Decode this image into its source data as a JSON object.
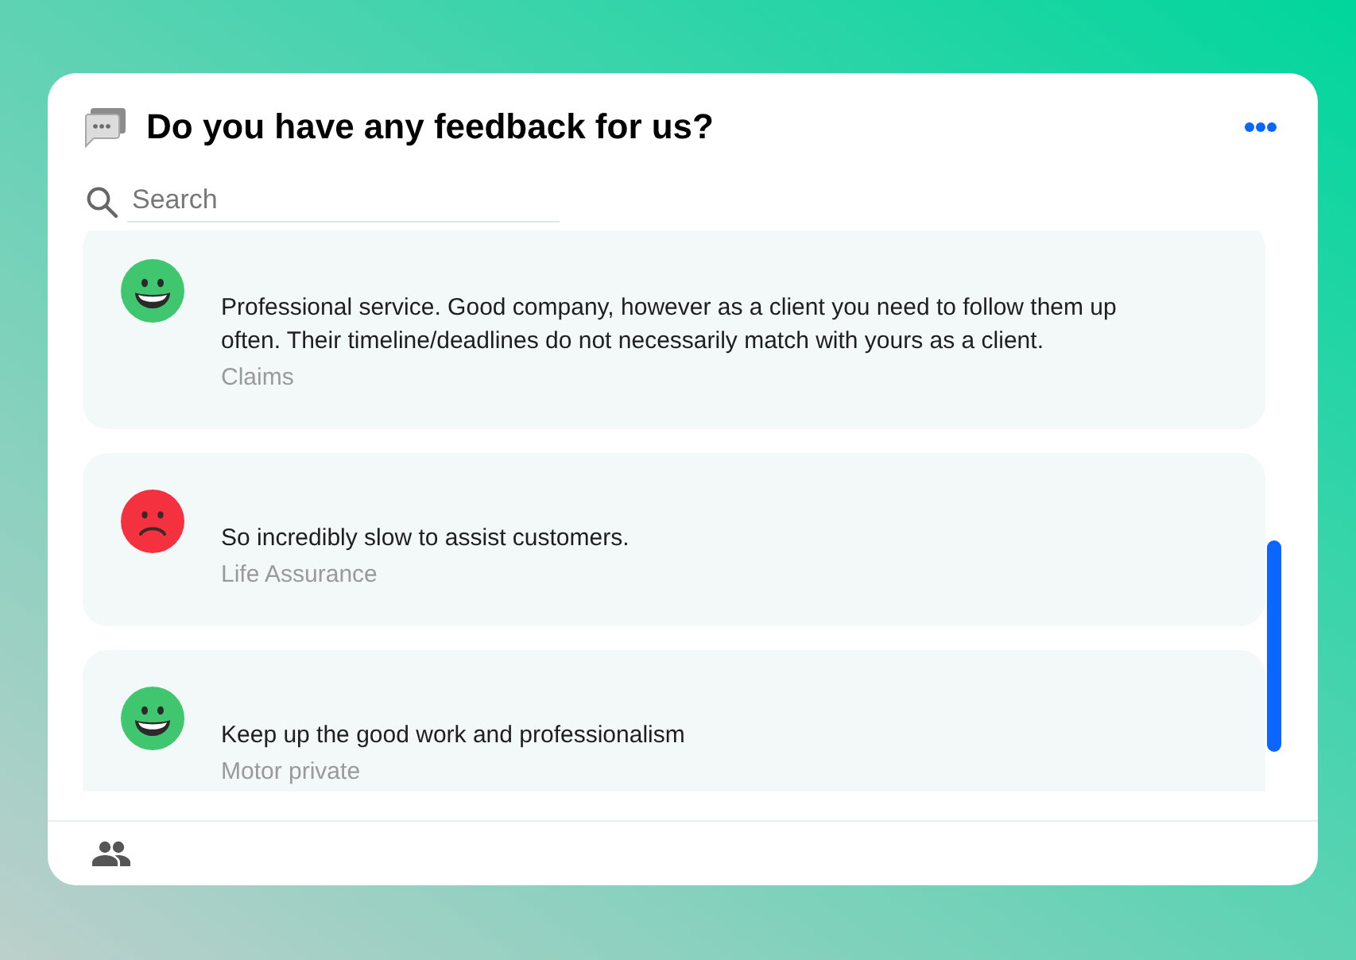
{
  "header": {
    "title": "Do you have any feedback for us?"
  },
  "search": {
    "placeholder": "Search"
  },
  "feedback": [
    {
      "kind": "positive",
      "text": "Professional service. Good company, however as a client you need to follow them up often. Their timeline/deadlines do not necessarily match with yours as a client.",
      "category": "Claims"
    },
    {
      "kind": "negative",
      "text": "So incredibly slow to assist customers.",
      "category": "Life Assurance"
    },
    {
      "kind": "positive",
      "text": "Keep up the good work and professionalism",
      "category": "Motor private"
    }
  ]
}
